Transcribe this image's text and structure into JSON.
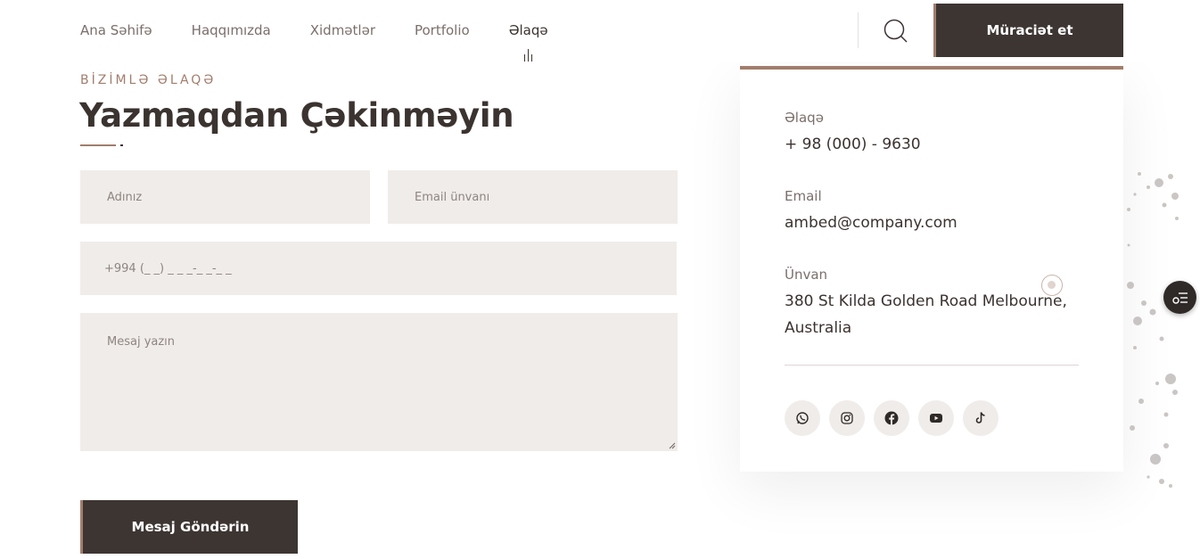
{
  "nav": {
    "items": [
      {
        "label": "Ana Səhifə"
      },
      {
        "label": "Haqqımızda"
      },
      {
        "label": "Xidmətlər"
      },
      {
        "label": "Portfolio"
      },
      {
        "label": "Əlaqə"
      }
    ],
    "active_index": 4,
    "search_icon": "search-icon",
    "apply_label": "Müraciət et"
  },
  "section": {
    "eyebrow": "BİZİMLƏ ƏLAQƏ",
    "title": "Yazmaqdan Çəkinməyin"
  },
  "form": {
    "name_placeholder": "Adınız",
    "email_placeholder": "Email ünvanı",
    "phone_placeholder": "+994  (_ _) _ _ _-_ _-_ _",
    "message_placeholder": "Mesaj yazın",
    "submit_label": "Mesaj Göndərin"
  },
  "contact": {
    "phone_label": "Əlaqə",
    "phone_value": "+ 98 (000) - 9630",
    "email_label": "Email",
    "email_value": "ambed@company.com",
    "address_label": "Ünvan",
    "address_line1": "380 St Kilda Golden Road Melbourne,",
    "address_line2": "Australia",
    "socials": [
      "whatsapp-icon",
      "instagram-icon",
      "facebook-icon",
      "youtube-icon",
      "tiktok-icon"
    ]
  },
  "colors": {
    "accent": "#a27d6d",
    "dark": "#3d3532",
    "field_bg": "#f0ecea",
    "text": "#3b3330",
    "muted": "#7a6f6b"
  }
}
